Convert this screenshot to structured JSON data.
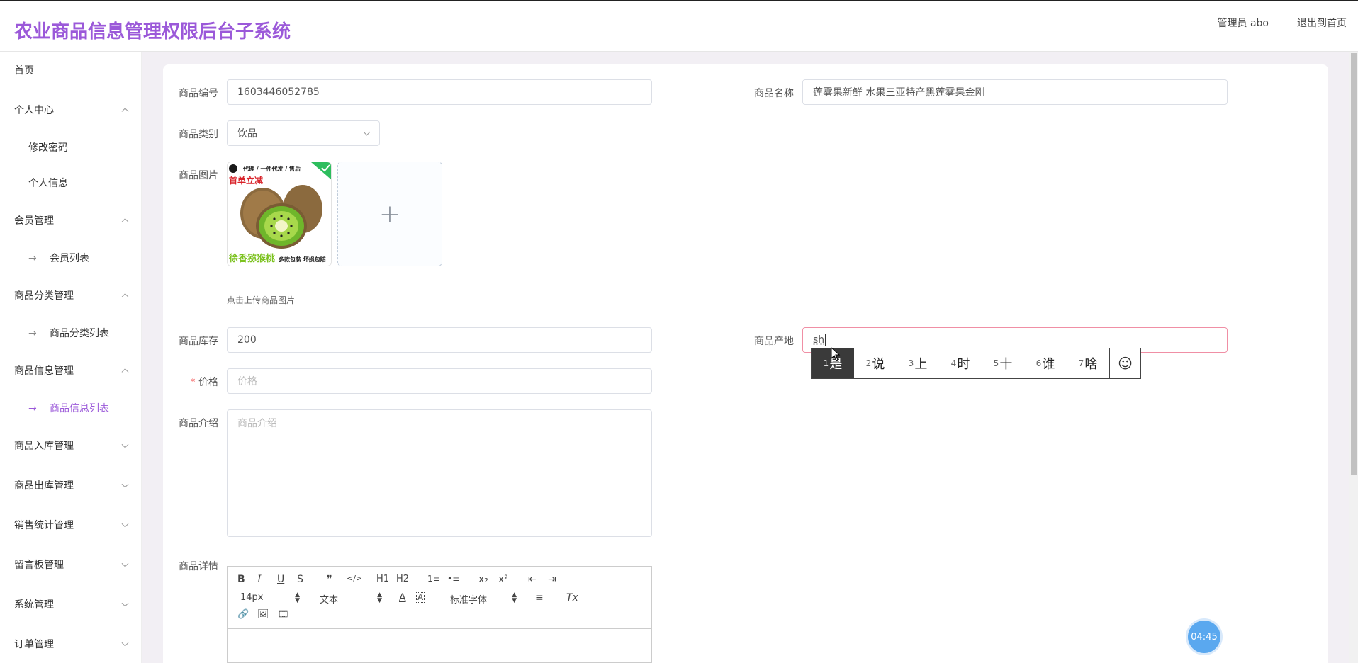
{
  "header": {
    "title": "农业商品信息管理权限后台子系统",
    "user": "管理员 abo",
    "exit": "退出到首页"
  },
  "sidebar": {
    "items": [
      {
        "label": "首页"
      },
      {
        "label": "个人中心",
        "expanded": true
      },
      {
        "label": "修改密码"
      },
      {
        "label": "个人信息"
      },
      {
        "label": "会员管理",
        "expanded": true
      },
      {
        "label": "会员列表"
      },
      {
        "label": "商品分类管理",
        "expanded": true
      },
      {
        "label": "商品分类列表"
      },
      {
        "label": "商品信息管理",
        "expanded": true
      },
      {
        "label": "商品信息列表",
        "active": true
      },
      {
        "label": "商品入库管理",
        "expanded": false
      },
      {
        "label": "商品出库管理",
        "expanded": false
      },
      {
        "label": "销售统计管理",
        "expanded": false
      },
      {
        "label": "留言板管理",
        "expanded": false
      },
      {
        "label": "系统管理",
        "expanded": false
      },
      {
        "label": "订单管理",
        "expanded": false
      }
    ]
  },
  "form": {
    "product_no": {
      "label": "商品编号",
      "value": "1603446052785"
    },
    "product_name": {
      "label": "商品名称",
      "value": "莲雾果新鲜 水果三亚特产黑莲雾果金刚"
    },
    "category": {
      "label": "商品类别",
      "value": "饮品"
    },
    "image": {
      "label": "商品图片",
      "hint": "点击上传商品图片",
      "add": "+"
    },
    "stock": {
      "label": "商品库存",
      "value": "200"
    },
    "origin": {
      "label": "商品产地",
      "value": "sh"
    },
    "price": {
      "label": "价格",
      "required_mark": "*",
      "placeholder": "价格"
    },
    "intro": {
      "label": "商品介绍",
      "placeholder": "商品介绍"
    },
    "detail": {
      "label": "商品详情"
    }
  },
  "thumbnail": {
    "banner": "代理 / 一件代发 / 售后",
    "promo": "首单立减",
    "brand": "徐香猕猴桃",
    "tag": "多款包装 坏损包赔"
  },
  "editor_toolbar": {
    "row1": [
      "B",
      "I",
      "U",
      "S",
      "❞",
      "</>",
      "H1",
      "H2",
      "1≡",
      "•≡",
      "x₂",
      "x²",
      "⇤",
      "⇥"
    ],
    "font_size": "14px",
    "format": "文本",
    "font_family": "标准字体",
    "row2_icons": [
      "A",
      "A",
      "≡",
      "Tx"
    ],
    "row3_icons": [
      "🔗",
      "🖼",
      "🎞"
    ]
  },
  "ime": {
    "candidates": [
      {
        "num": "1",
        "char": "是",
        "selected": true
      },
      {
        "num": "2",
        "char": "说"
      },
      {
        "num": "3",
        "char": "上"
      },
      {
        "num": "4",
        "char": "时"
      },
      {
        "num": "5",
        "char": "十"
      },
      {
        "num": "6",
        "char": "谁"
      },
      {
        "num": "7",
        "char": "啥"
      }
    ],
    "emoji": "☺"
  },
  "timer": "04:45",
  "colors": {
    "brand": "#9b59d9",
    "main_bg": "#f2eff4",
    "focus_border": "#f08fa5",
    "timer_bg": "#5aa8ef"
  }
}
